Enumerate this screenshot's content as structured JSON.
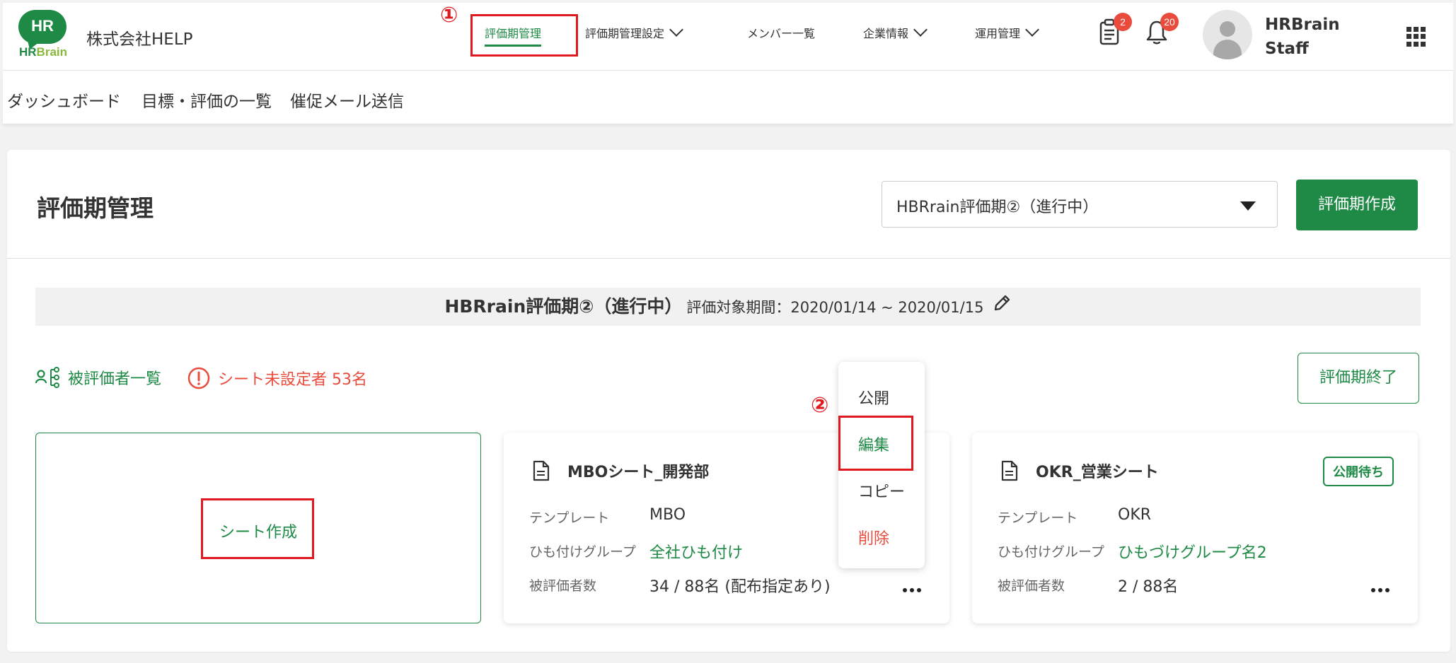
{
  "header": {
    "logo_text": "HR",
    "logo_brand_1": "HR",
    "logo_brand_2": "Brain",
    "company": "株式会社HELP",
    "nav": [
      {
        "label": "評価期管理"
      },
      {
        "label": "評価期管理設定"
      },
      {
        "label": "メンバー一覧"
      },
      {
        "label": "企業情報"
      },
      {
        "label": "運用管理"
      }
    ],
    "doc_badge": "2",
    "bell_badge": "20",
    "user_line1": "HRBrain",
    "user_line2": "Staff"
  },
  "subnav": [
    "ダッシュボード",
    "目標・評価の一覧",
    "催促メール送信"
  ],
  "annotations": {
    "step1": "①",
    "step2": "②"
  },
  "main": {
    "title": "評価期管理",
    "select_value": "HBRrain評価期②（進行中）",
    "create_period_button": "評価期作成",
    "period_name": "HBRrain評価期②（進行中）",
    "period_range": "評価対象期間：2020/01/14 ~ 2020/01/15",
    "evaluatee_list_link": "被評価者一覧",
    "unset_warning": "シート未設定者 53名",
    "end_period_button": "評価期終了",
    "create_sheet": "シート作成",
    "labels": {
      "template": "テンプレート",
      "group": "ひも付けグループ",
      "count": "被評価者数"
    },
    "sheets": [
      {
        "title": "MBOシート_開発部",
        "template": "MBO",
        "group": "全社ひも付け",
        "count": "34 / 88名 (配布指定あり)"
      },
      {
        "title": "OKR_営業シート",
        "template": "OKR",
        "group": "ひもづけグループ名2",
        "count": "2 / 88名",
        "status": "公開待ち"
      }
    ],
    "context_menu": [
      "公開",
      "編集",
      "コピー",
      "削除"
    ]
  },
  "colors": {
    "accent": "#1e8a45",
    "danger": "#e94b3c",
    "highlight": "#e0191f"
  }
}
